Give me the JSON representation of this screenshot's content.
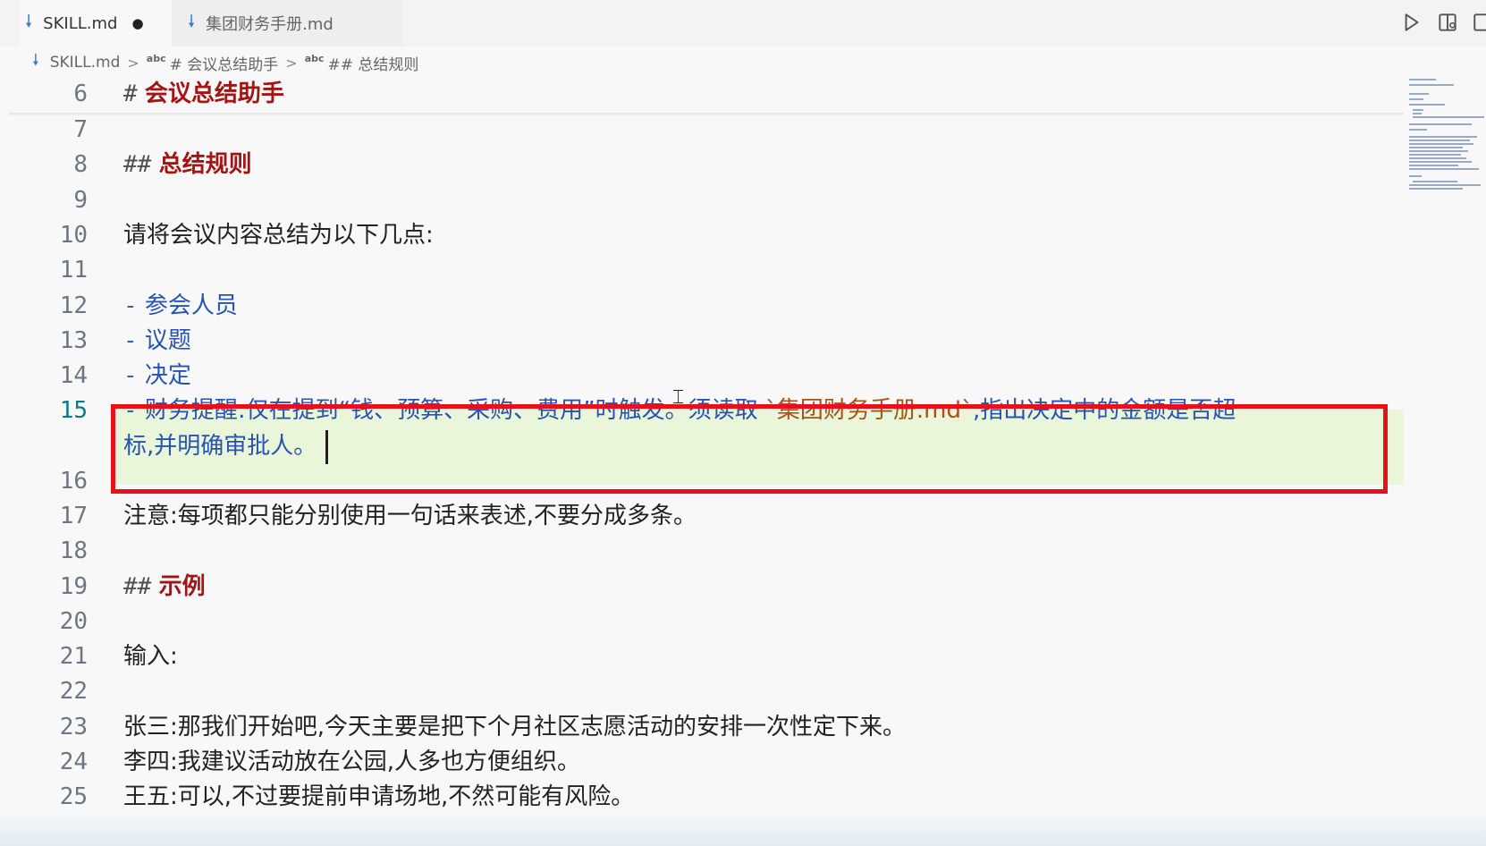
{
  "tabs": [
    {
      "label": "SKILL.md",
      "modified_indicator": "●"
    },
    {
      "label": "集团财务手册.md"
    }
  ],
  "breadcrumb": {
    "file": "SKILL.md",
    "symbol_prefix": "abc",
    "items": [
      "# 会议总结助手",
      "## 总结规则"
    ]
  },
  "editor": {
    "active_line": 15,
    "lines": [
      {
        "n": "6",
        "hash": "#",
        "heading": "会议总结助手"
      },
      {
        "n": "7"
      },
      {
        "n": "8",
        "hash": "##",
        "heading": "总结规则"
      },
      {
        "n": "9"
      },
      {
        "n": "10",
        "text": "请将会议内容总结为以下几点:"
      },
      {
        "n": "11"
      },
      {
        "n": "12",
        "bullet": "-",
        "item": "参会人员"
      },
      {
        "n": "13",
        "bullet": "-",
        "item": "议题"
      },
      {
        "n": "14",
        "bullet": "-",
        "item": "决定"
      },
      {
        "n": "15",
        "bullet": "-",
        "item_part1": "财务提醒:仅在提到“钱、预算、采购、费用”时触发。须读取 ",
        "item_code": "`集团财务手册.md`",
        "item_part2": ",指出决定中的金额是否超",
        "item_wrap": "标,并明确审批人。"
      },
      {
        "n": "16"
      },
      {
        "n": "17",
        "text": "注意:每项都只能分别使用一句话来表述,不要分成多条。"
      },
      {
        "n": "18"
      },
      {
        "n": "19",
        "hash": "##",
        "heading": "示例"
      },
      {
        "n": "20"
      },
      {
        "n": "21",
        "text": "输入:"
      },
      {
        "n": "22"
      },
      {
        "n": "23",
        "text": "张三:那我们开始吧,今天主要是把下个月社区志愿活动的安排一次性定下来。"
      },
      {
        "n": "24",
        "text": "李四:我建议活动放在公园,人多也方便组织。"
      },
      {
        "n": "25",
        "text": "王五:可以,不过要提前申请场地,不然可能有风险。"
      }
    ]
  }
}
